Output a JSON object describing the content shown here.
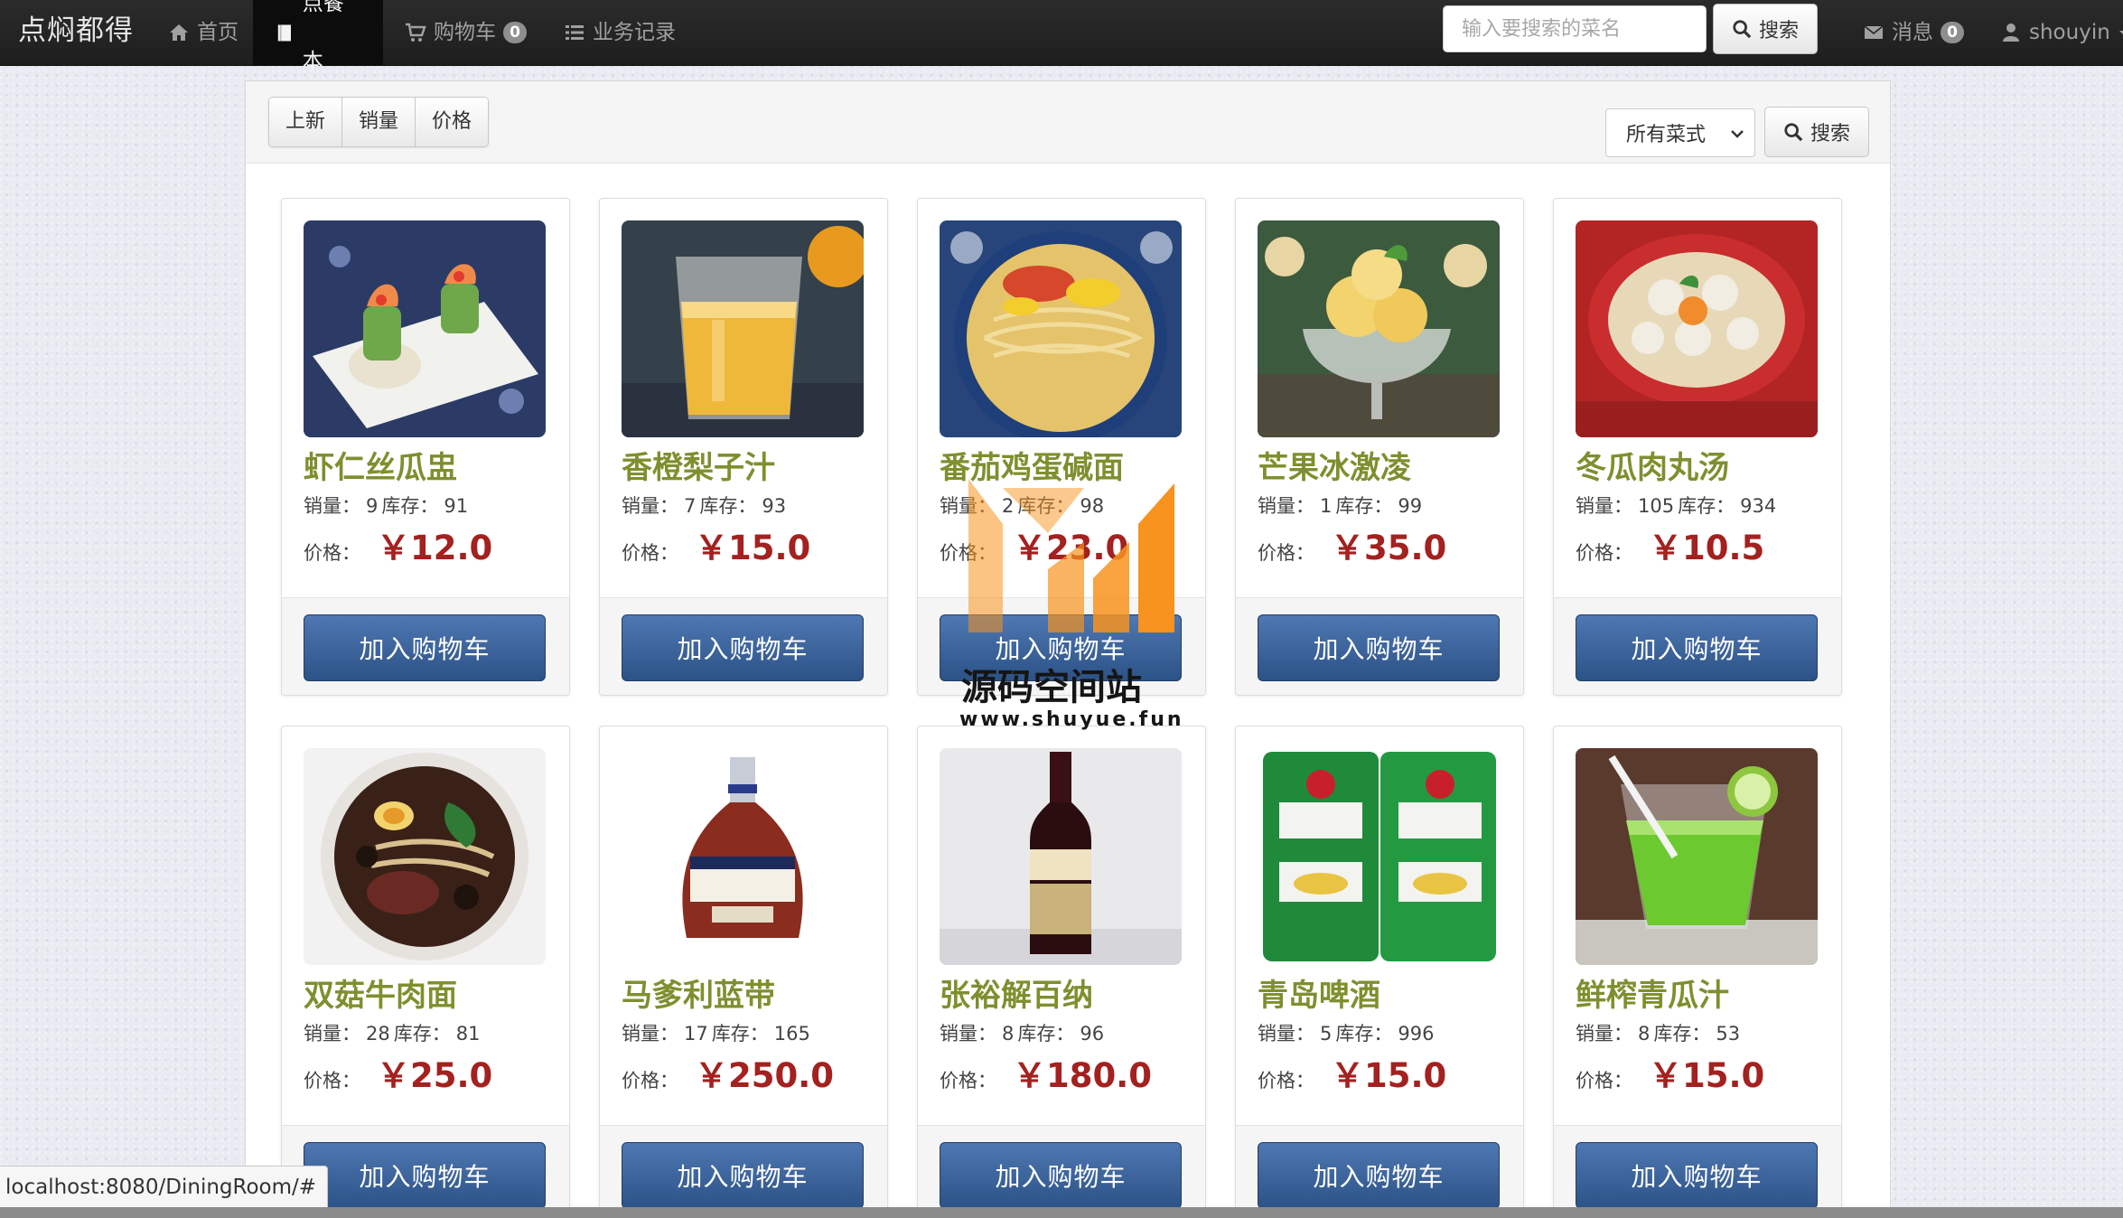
{
  "navbar": {
    "brand": "点焖都得",
    "items": [
      {
        "label": "首页",
        "icon": "home-icon"
      },
      {
        "label": "点餐本",
        "icon": "book-icon",
        "active": true
      },
      {
        "label": "购物车",
        "icon": "cart-icon",
        "badge": "0"
      },
      {
        "label": "业务记录",
        "icon": "list-icon"
      }
    ],
    "search_placeholder": "输入要搜索的菜名",
    "search_button": "搜索",
    "messages_label": "消息",
    "messages_badge": "0",
    "user": "shouyin"
  },
  "toolbar": {
    "sort_buttons": [
      "上新",
      "销量",
      "价格"
    ],
    "category_select": "所有菜式",
    "search_button": "搜索"
  },
  "labels": {
    "sales": "销量：",
    "stock": "库存：",
    "price": "价格：",
    "add_to_cart": "加入购物车",
    "currency": "￥"
  },
  "dishes": [
    {
      "name": "虾仁丝瓜盅",
      "sales": "9",
      "stock": "91",
      "price": "￥12.0",
      "image": "shrimp-loofah-photo"
    },
    {
      "name": "香橙梨子汁",
      "sales": "7",
      "stock": "93",
      "price": "￥15.0",
      "image": "orange-juice-photo"
    },
    {
      "name": "番茄鸡蛋碱面",
      "sales": "2",
      "stock": "98",
      "price": "￥23.0",
      "image": "tomato-egg-noodle-photo"
    },
    {
      "name": "芒果冰激凌",
      "sales": "1",
      "stock": "99",
      "price": "￥35.0",
      "image": "mango-icecream-photo"
    },
    {
      "name": "冬瓜肉丸汤",
      "sales": "105",
      "stock": "934",
      "price": "￥10.5",
      "image": "meatball-soup-photo"
    },
    {
      "name": "双菇牛肉面",
      "sales": "28",
      "stock": "81",
      "price": "￥25.0",
      "image": "beef-noodle-photo"
    },
    {
      "name": "马爹利蓝带",
      "sales": "17",
      "stock": "165",
      "price": "￥250.0",
      "image": "martell-bottle-photo"
    },
    {
      "name": "张裕解百纳",
      "sales": "8",
      "stock": "96",
      "price": "￥180.0",
      "image": "changyu-wine-photo"
    },
    {
      "name": "青岛啤酒",
      "sales": "5",
      "stock": "996",
      "price": "￥15.0",
      "image": "tsingtao-beer-photo"
    },
    {
      "name": "鲜榨青瓜汁",
      "sales": "8",
      "stock": "53",
      "price": "￥15.0",
      "image": "cucumber-juice-photo"
    }
  ],
  "watermark": {
    "title": "源码空间站",
    "url": "www.shuyue.fun"
  },
  "status_bar": "localhost:8080/DiningRoom/#",
  "colors": {
    "navbar": "#222222",
    "dish_name": "#7f8f2e",
    "price": "#a3211f",
    "add_button": "#3a629b",
    "watermark_orange": "#f7931e"
  }
}
